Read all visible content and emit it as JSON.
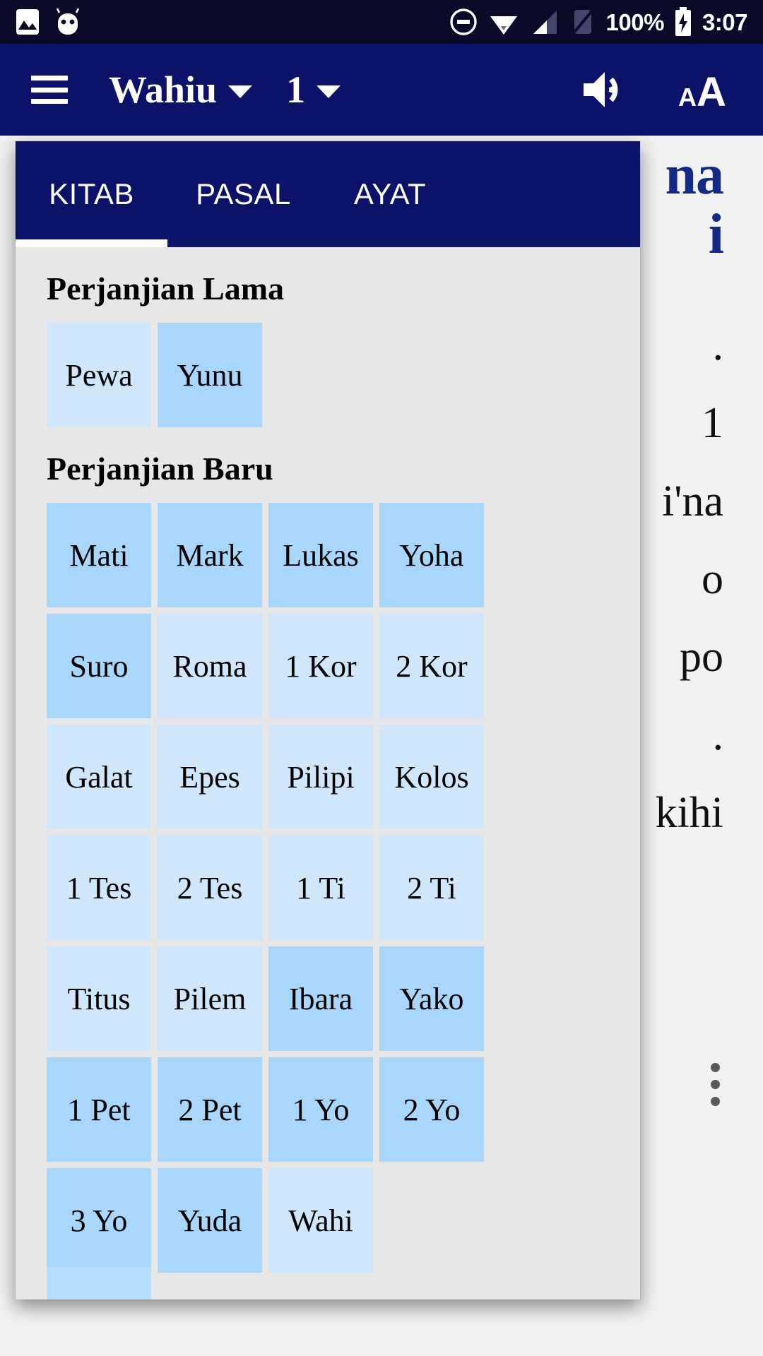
{
  "status_bar": {
    "icons": [
      "image-icon",
      "android-robot-icon",
      "do-not-disturb-icon",
      "wifi-icon",
      "signal-icon",
      "sim-none-icon",
      "battery-charging-icon"
    ],
    "battery_percent": "100%",
    "time": "3:07"
  },
  "app_bar": {
    "menu_icon": "hamburger-menu-icon",
    "book_label": "Wahiu",
    "chapter_label": "1",
    "speaker_icon": "volume-up-icon",
    "font_size_icon": "font-size-icon"
  },
  "reader": {
    "title_line1": "na",
    "title_line2": "i",
    "lines": [
      ".",
      "1",
      "",
      "i'na",
      "o",
      "po",
      ".",
      "kihi"
    ]
  },
  "overflow": {
    "icon": "more-vertical-icon"
  },
  "popup": {
    "tabs": [
      {
        "label": "KITAB",
        "active": true
      },
      {
        "label": "PASAL",
        "active": false
      },
      {
        "label": "AYAT",
        "active": false
      }
    ],
    "sections": [
      {
        "title": "Perjanjian Lama",
        "books": [
          {
            "label": "Pewa",
            "shade": "light"
          },
          {
            "label": "Yunu",
            "shade": "mid"
          }
        ]
      },
      {
        "title": "Perjanjian Baru",
        "books": [
          {
            "label": "Mati",
            "shade": "mid"
          },
          {
            "label": "Mark",
            "shade": "mid"
          },
          {
            "label": "Lukas",
            "shade": "mid"
          },
          {
            "label": "Yoha",
            "shade": "mid"
          },
          {
            "label": "Suro",
            "shade": "mid"
          },
          {
            "label": "Roma",
            "shade": "light"
          },
          {
            "label": "1 Kor",
            "shade": "light"
          },
          {
            "label": "2 Kor",
            "shade": "light"
          },
          {
            "label": "Galat",
            "shade": "light"
          },
          {
            "label": "Epes",
            "shade": "light"
          },
          {
            "label": "Pilipi",
            "shade": "light"
          },
          {
            "label": "Kolos",
            "shade": "light"
          },
          {
            "label": "1 Tes",
            "shade": "light"
          },
          {
            "label": "2 Tes",
            "shade": "light"
          },
          {
            "label": "1 Ti",
            "shade": "light"
          },
          {
            "label": "2 Ti",
            "shade": "light"
          },
          {
            "label": "Titus",
            "shade": "light"
          },
          {
            "label": "Pilem",
            "shade": "light"
          },
          {
            "label": "Ibara",
            "shade": "mid"
          },
          {
            "label": "Yako",
            "shade": "mid"
          },
          {
            "label": "1 Pet",
            "shade": "mid"
          },
          {
            "label": "2 Pet",
            "shade": "mid"
          },
          {
            "label": "1 Yo",
            "shade": "mid"
          },
          {
            "label": "2 Yo",
            "shade": "mid"
          },
          {
            "label": "3 Yo",
            "shade": "mid"
          },
          {
            "label": "Yuda",
            "shade": "mid"
          },
          {
            "label": "Wahi",
            "shade": "light"
          }
        ]
      }
    ]
  },
  "colors": {
    "status_bar_bg": "#0a0a28",
    "app_bar_bg": "#0b1268",
    "panel_bg": "#e7e7e7",
    "reader_bg": "#f2f2f2",
    "title_blue": "#132a86",
    "tile_light": "#cfe6fb",
    "tile_mid": "#a9d6fb"
  }
}
